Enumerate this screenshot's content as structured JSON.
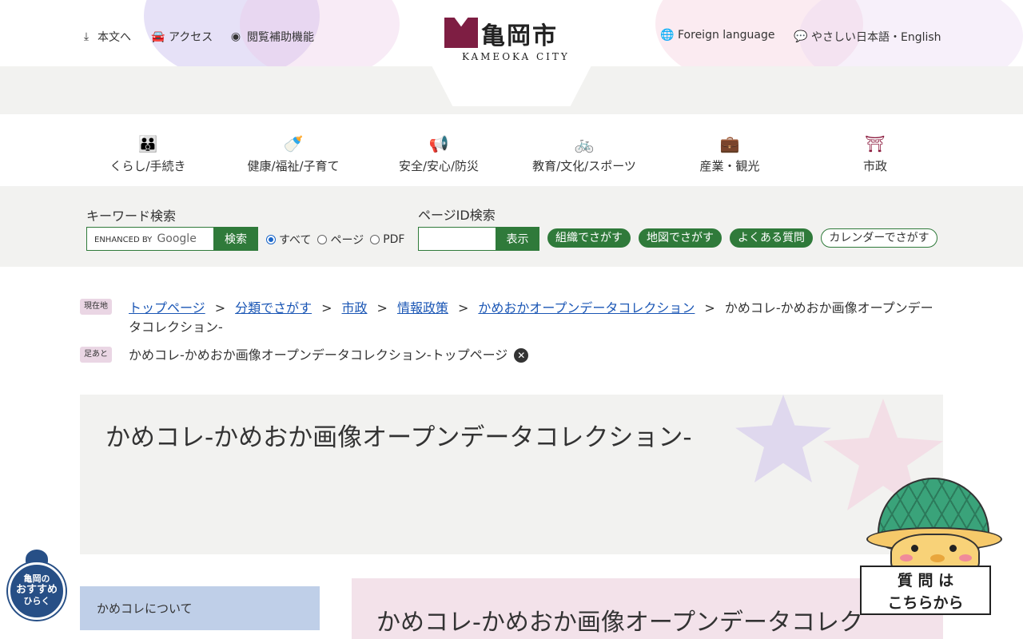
{
  "header": {
    "utility_left": [
      {
        "label": "本文へ",
        "icon": "download-icon"
      },
      {
        "label": "アクセス",
        "icon": "car-icon"
      },
      {
        "label": "閲覧補助機能",
        "icon": "eye-icon"
      }
    ],
    "utility_right": [
      {
        "label": "Foreign language",
        "icon": "globe-icon"
      },
      {
        "label": "やさしい日本語・English",
        "icon": "speech-bubble-icon"
      }
    ],
    "logo": {
      "name": "亀岡市",
      "subtitle": "KAMEOKA CITY"
    }
  },
  "global_nav": [
    {
      "label": "くらし/手続き",
      "icon": "family-icon"
    },
    {
      "label": "健康/福祉/子育て",
      "icon": "baby-bottle-icon"
    },
    {
      "label": "安全/安心/防災",
      "icon": "megaphone-icon"
    },
    {
      "label": "教育/文化/スポーツ",
      "icon": "bicycle-icon"
    },
    {
      "label": "産業・観光",
      "icon": "briefcase-icon"
    },
    {
      "label": "市政",
      "icon": "city-emblem-icon"
    }
  ],
  "search": {
    "keyword_label": "キーワード検索",
    "google_prefix": "ENHANCED BY",
    "google_name": "Google",
    "search_button": "検索",
    "scope_options": [
      "すべて",
      "ページ",
      "PDF"
    ],
    "scope_selected": "すべて",
    "page_id_label": "ページID検索",
    "page_id_button": "表示",
    "quick_links": [
      "組織でさがす",
      "地図でさがす",
      "よくある質問",
      "カレンダーでさがす"
    ]
  },
  "breadcrumb": {
    "tag": "現在地",
    "links": [
      "トップページ",
      "分類でさがす",
      "市政",
      "情報政策",
      "かめおかオープンデータコレクション"
    ],
    "separator": ">",
    "current": "かめコレ-かめおか画像オープンデータコレクション-"
  },
  "history": {
    "tag": "足あと",
    "item": "かめコレ-かめおか画像オープンデータコレクション-トップページ",
    "close_icon": "close-circle-icon"
  },
  "page": {
    "title": "かめコレ-かめおか画像オープンデータコレクション-",
    "side_item": "かめコレについて",
    "content_heading": "かめコレ-かめおか画像オープンデータコレク"
  },
  "floating": {
    "osusume_lines": [
      "亀岡の",
      "おすすめ",
      "ひらく"
    ],
    "mascot_sign_lines": [
      "質 問 は",
      "こちらから"
    ]
  },
  "colors": {
    "brand": "#8c1c3f",
    "green": "#2f7a3a",
    "link": "#1a56b5",
    "band_gray": "#f2f2f0",
    "side_blue": "#bfcfe8",
    "content_pink": "#f3e2ea"
  }
}
